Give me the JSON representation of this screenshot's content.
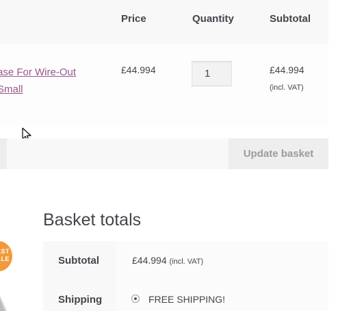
{
  "cart": {
    "headers": {
      "price": "Price",
      "quantity": "Quantity",
      "subtotal": "Subtotal"
    },
    "item": {
      "product_name_line1": "ase For Wire-Out",
      "product_name_line2": "Small",
      "price": "£44.994",
      "quantity": "1",
      "subtotal": "£44.994",
      "subtotal_note": "(incl. VAT)"
    },
    "update_button": "Update basket"
  },
  "badge": {
    "line1": "EST",
    "line2": "LLE"
  },
  "totals": {
    "title": "Basket totals",
    "subtotal_label": "Subtotal",
    "subtotal_value": "£44.994",
    "subtotal_note": "(incl. VAT)",
    "shipping_label": "Shipping",
    "shipping_option": "FREE SHIPPING!"
  },
  "colors": {
    "link": "#96588a",
    "badge": "#f29a3a",
    "text": "#43454b"
  },
  "icons": [
    "mouse-cursor-icon",
    "radio-selected-icon"
  ]
}
